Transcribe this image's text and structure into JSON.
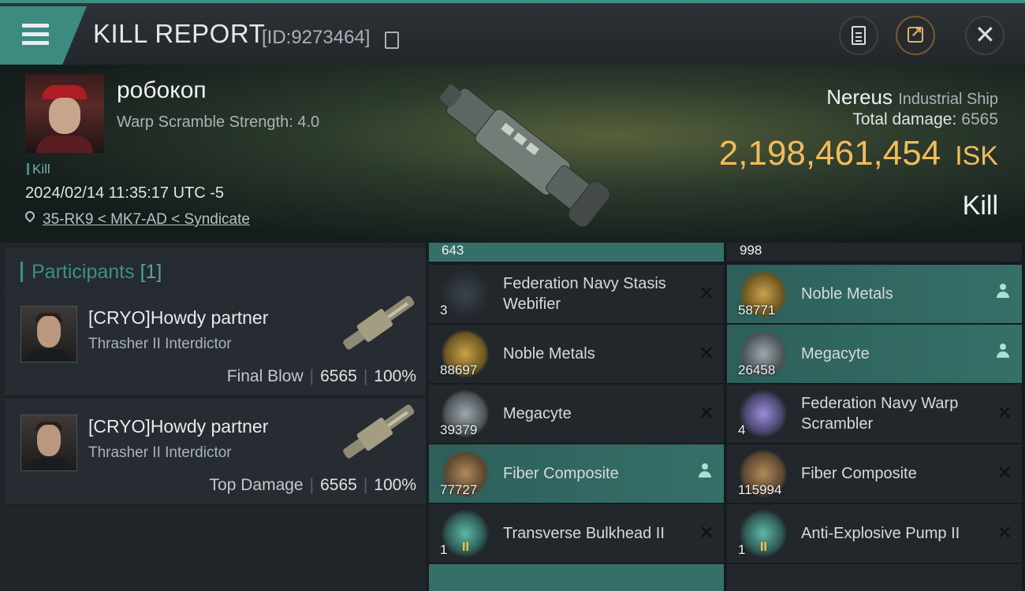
{
  "header": {
    "title": "KILL REPORT",
    "report_id": "[ID:9273464]"
  },
  "victim": {
    "pilot_name": "робокоп",
    "warp_scramble": "Warp Scramble Strength: 4.0",
    "kill_tag": "Kill",
    "datetime": "2024/02/14 11:35:17 UTC -5",
    "location": "35-RK9 < MK7-AD < Syndicate",
    "ship_name": "Nereus",
    "ship_class": "Industrial Ship",
    "total_damage_label": "Total damage:",
    "total_damage": "6565",
    "isk_value": "2,198,461,454",
    "isk_unit": "ISK",
    "result": "Kill"
  },
  "participants": {
    "title": "Participants",
    "count": "[1]",
    "rows": [
      {
        "name": "[CRYO]Howdy partner",
        "ship": "Thrasher II Interdictor",
        "role": "Final Blow",
        "damage": "6565",
        "percent": "100%"
      },
      {
        "name": "[CRYO]Howdy partner",
        "ship": "Thrasher II Interdictor",
        "role": "Top Damage",
        "damage": "6565",
        "percent": "100%"
      }
    ]
  },
  "items": {
    "stub_left_qty": "643",
    "stub_right_qty": "998",
    "left": [
      {
        "name": "Federation Navy Stasis Webifier",
        "qty": "3",
        "dropped": false,
        "icon": "stasis-webifier-icon"
      },
      {
        "name": "Noble Metals",
        "qty": "88697",
        "dropped": false,
        "icon": "noble-metals-icon"
      },
      {
        "name": "Megacyte",
        "qty": "39379",
        "dropped": false,
        "icon": "megacyte-icon"
      },
      {
        "name": "Fiber Composite",
        "qty": "77727",
        "dropped": true,
        "icon": "fiber-composite-icon"
      },
      {
        "name": "Transverse Bulkhead II",
        "qty": "1",
        "dropped": false,
        "icon": "rig-icon"
      }
    ],
    "right": [
      {
        "name": "Noble Metals",
        "qty": "58771",
        "dropped": true,
        "icon": "noble-metals-icon"
      },
      {
        "name": "Megacyte",
        "qty": "26458",
        "dropped": true,
        "icon": "megacyte-icon"
      },
      {
        "name": "Federation Navy Warp Scrambler",
        "qty": "4",
        "dropped": false,
        "icon": "warp-scrambler-icon"
      },
      {
        "name": "Fiber Composite",
        "qty": "115994",
        "dropped": false,
        "icon": "fiber-composite-icon"
      },
      {
        "name": "Anti-Explosive Pump II",
        "qty": "1",
        "dropped": false,
        "icon": "rig-icon"
      }
    ]
  },
  "colors": {
    "accent": "#3d8f86",
    "isk": "#f2bb5c",
    "dropped_row": "#347068"
  }
}
